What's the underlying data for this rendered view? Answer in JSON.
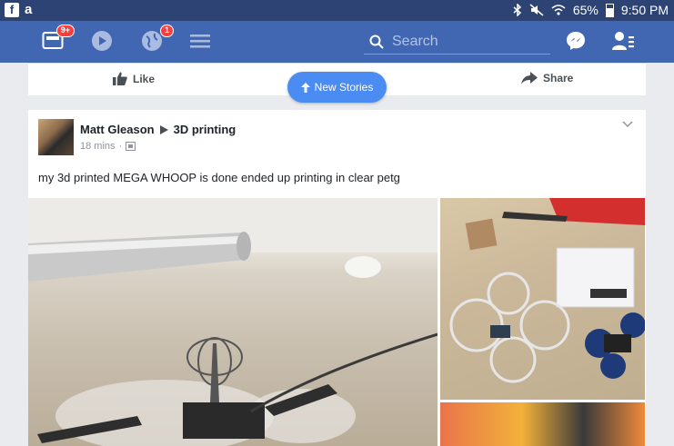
{
  "statusbar": {
    "left_icons": [
      "facebook-icon",
      "amazon-icon"
    ],
    "battery": "65%",
    "time": "9:50 PM"
  },
  "navbar": {
    "news_badge": "9+",
    "notifications_badge": "1",
    "search_placeholder": "Search"
  },
  "actions": {
    "like": "Like",
    "share": "Share"
  },
  "new_stories": "New Stories",
  "post": {
    "author": "Matt Gleason",
    "group": "3D printing",
    "time": "18 mins",
    "text": "my 3d printed MEGA WHOOP is done ended up printing in clear petg"
  },
  "colors": {
    "navbar": "#4267b2",
    "statusbar": "#2d4373",
    "pill": "#4b8cf2",
    "badge": "#fa3e3e"
  }
}
